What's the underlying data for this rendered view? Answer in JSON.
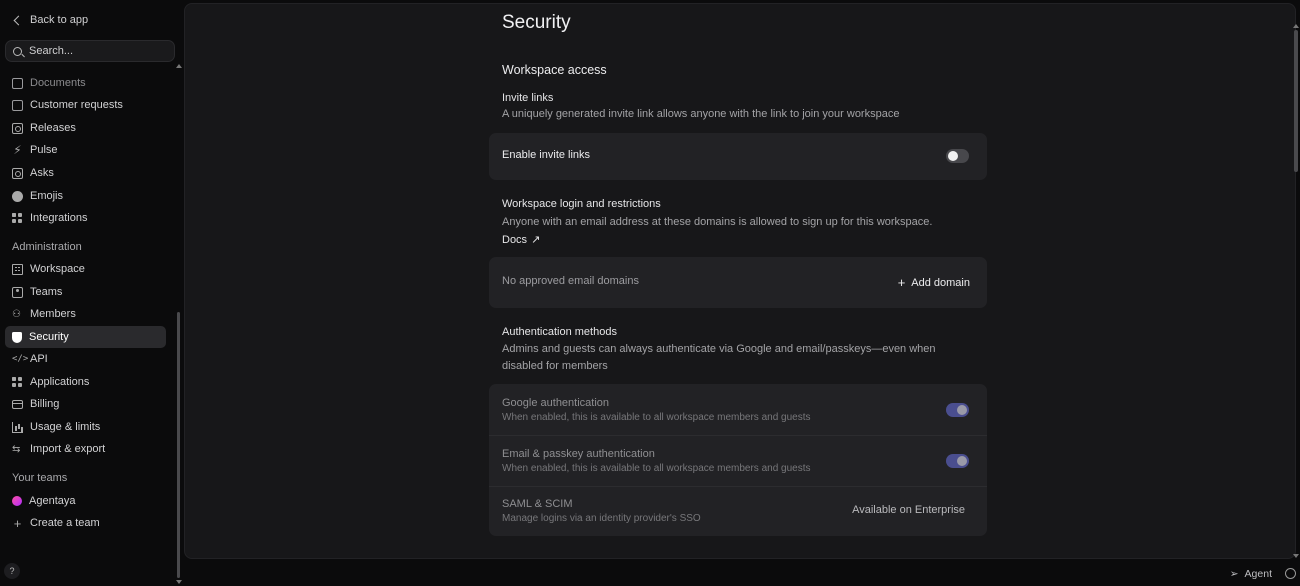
{
  "sidebar": {
    "back_label": "Back to app",
    "search_placeholder": "Search...",
    "items_top": [
      {
        "label": "Documents",
        "icon": "document-icon"
      },
      {
        "label": "Customer requests",
        "icon": "customer-requests-icon"
      },
      {
        "label": "Releases",
        "icon": "releases-icon"
      },
      {
        "label": "Pulse",
        "icon": "pulse-icon"
      },
      {
        "label": "Asks",
        "icon": "asks-icon"
      },
      {
        "label": "Emojis",
        "icon": "emoji-icon"
      },
      {
        "label": "Integrations",
        "icon": "integrations-icon"
      }
    ],
    "admin_heading": "Administration",
    "admin_items": [
      {
        "label": "Workspace",
        "icon": "workspace-icon"
      },
      {
        "label": "Teams",
        "icon": "teams-icon"
      },
      {
        "label": "Members",
        "icon": "members-icon"
      },
      {
        "label": "Security",
        "icon": "shield-icon"
      },
      {
        "label": "API",
        "icon": "code-icon"
      },
      {
        "label": "Applications",
        "icon": "applications-icon"
      },
      {
        "label": "Billing",
        "icon": "billing-icon"
      },
      {
        "label": "Usage & limits",
        "icon": "chart-icon"
      },
      {
        "label": "Import & export",
        "icon": "swap-icon"
      }
    ],
    "teams_heading": "Your teams",
    "team_name": "Agentaya",
    "create_team": "Create a team",
    "help_label": "?"
  },
  "page": {
    "title": "Security",
    "workspace_access": "Workspace access",
    "invite_links_title": "Invite links",
    "invite_links_desc": "A uniquely generated invite link allows anyone with the link to join your workspace",
    "enable_invite_label": "Enable invite links",
    "enable_invite_on": false,
    "login_title": "Workspace login and restrictions",
    "login_desc": "Anyone with an email address at these domains is allowed to sign up for this workspace.",
    "docs_label": "Docs",
    "no_domains": "No approved email domains",
    "add_domain": "Add domain",
    "auth_title": "Authentication methods",
    "auth_desc": "Admins and guests can always authenticate via Google and email/passkeys—even when disabled for members",
    "auth_rows": [
      {
        "label": "Google authentication",
        "sub": "When enabled, this is available to all workspace members and guests",
        "on": true
      },
      {
        "label": "Email & passkey authentication",
        "sub": "When enabled, this is available to all workspace members and guests",
        "on": true
      }
    ],
    "saml_label": "SAML & SCIM",
    "saml_sub": "Manage logins via an identity provider's SSO",
    "saml_status": "Available on Enterprise"
  },
  "footer": {
    "agent_label": "Agent"
  }
}
